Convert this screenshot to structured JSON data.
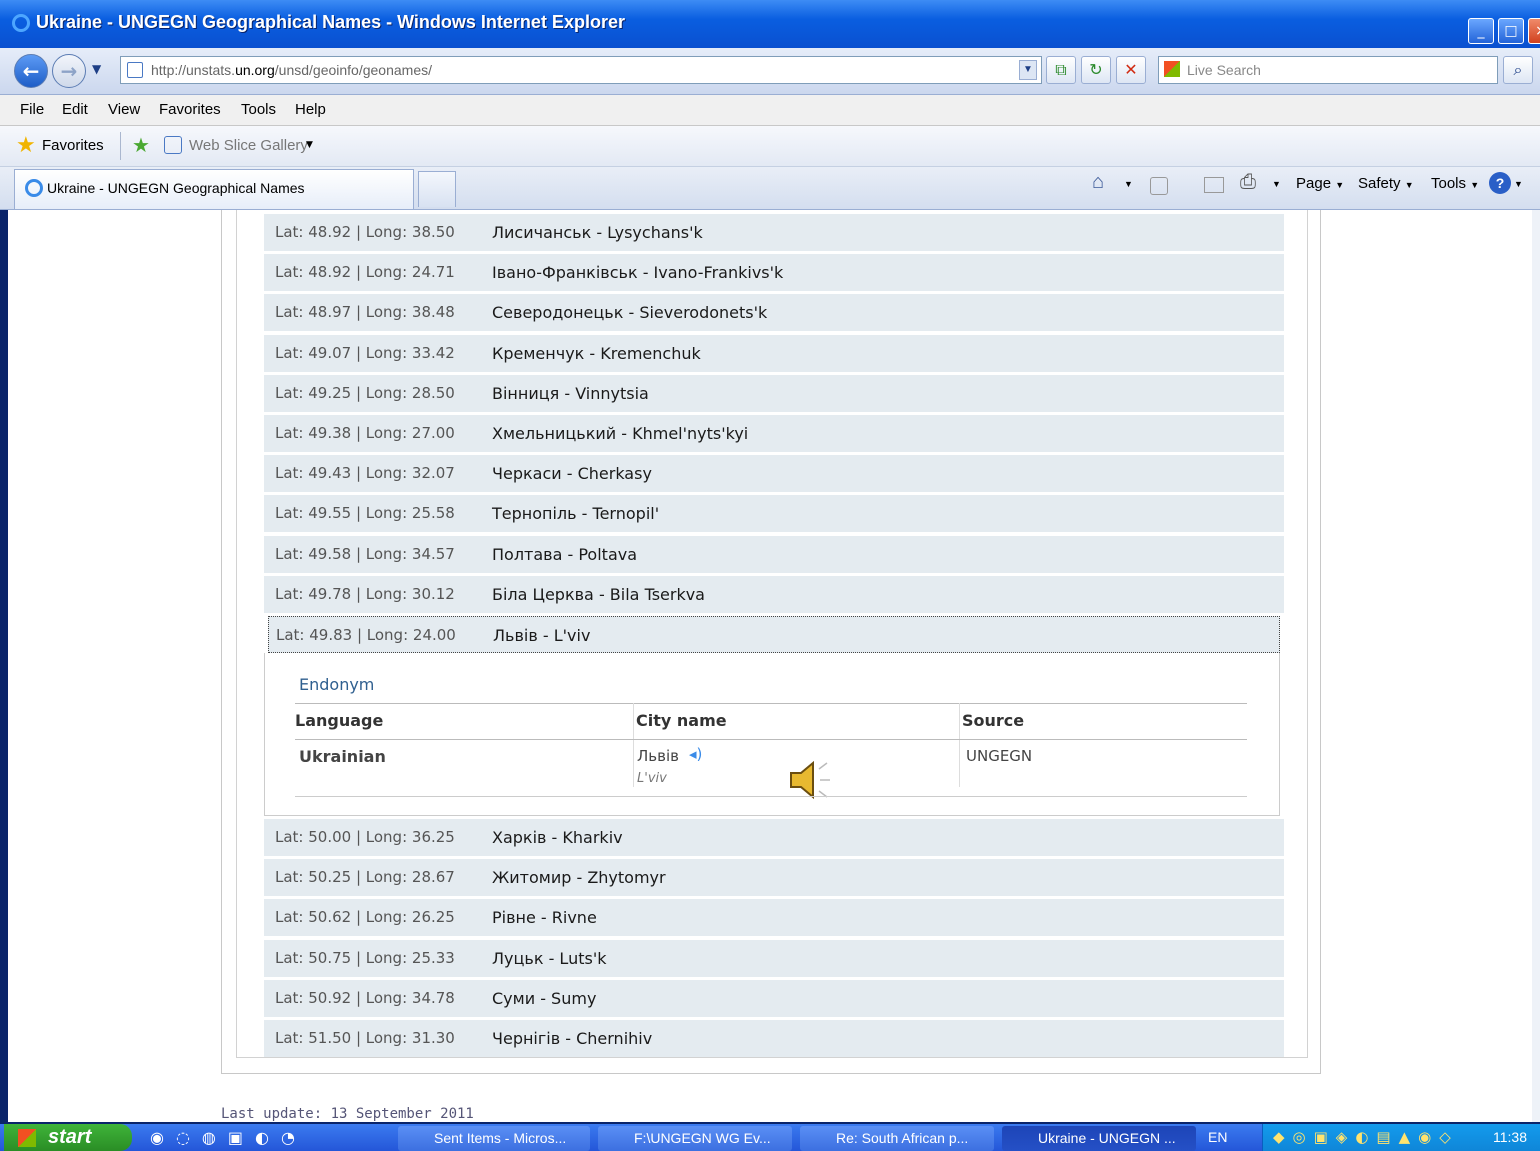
{
  "window": {
    "title": "Ukraine - UNGEGN Geographical Names - Windows Internet Explorer"
  },
  "nav": {
    "url_prefix": "http://unstats.",
    "url_domain": "un.org",
    "url_path": "/unsd/geoinfo/geonames/",
    "search_placeholder": "Live Search"
  },
  "menu": [
    "File",
    "Edit",
    "View",
    "Favorites",
    "Tools",
    "Help"
  ],
  "favorites": {
    "label": "Favorites",
    "web_slice": "Web Slice Gallery"
  },
  "tab": {
    "title": "Ukraine - UNGEGN Geographical Names"
  },
  "commands": {
    "page": "Page",
    "safety": "Safety",
    "tools": "Tools"
  },
  "rows_before": [
    {
      "coords": "Lat: 48.92 | Long: 38.50",
      "name": "Лисичанськ - Lysychans'k"
    },
    {
      "coords": "Lat: 48.92 | Long: 24.71",
      "name": "Івано-Франківськ - Ivano-Frankivs'k"
    },
    {
      "coords": "Lat: 48.97 | Long: 38.48",
      "name": "Северодонецьк - Sieverodonets'k"
    },
    {
      "coords": "Lat: 49.07 | Long: 33.42",
      "name": "Кременчук - Kremenchuk"
    },
    {
      "coords": "Lat: 49.25 | Long: 28.50",
      "name": "Вінниця - Vinnytsia"
    },
    {
      "coords": "Lat: 49.38 | Long: 27.00",
      "name": "Хмельницький - Khmel'nyts'kyi"
    },
    {
      "coords": "Lat: 49.43 | Long: 32.07",
      "name": "Черкаси - Cherkasy"
    },
    {
      "coords": "Lat: 49.55 | Long: 25.58",
      "name": "Тернопіль - Ternopil'"
    },
    {
      "coords": "Lat: 49.58 | Long: 34.57",
      "name": "Полтава - Poltava"
    },
    {
      "coords": "Lat: 49.78 | Long: 30.12",
      "name": "Біла Церква - Bila Tserkva"
    }
  ],
  "selected_row": {
    "coords": "Lat: 49.83 | Long: 24.00",
    "name": "Львів - L'viv"
  },
  "detail": {
    "section": "Endonym",
    "headers": {
      "language": "Language",
      "city": "City name",
      "source": "Source"
    },
    "language": "Ukrainian",
    "city_name": "Львів",
    "city_translit": "L'viv",
    "source": "UNGEGN"
  },
  "rows_after": [
    {
      "coords": "Lat: 50.00 | Long: 36.25",
      "name": "Харків - Kharkiv"
    },
    {
      "coords": "Lat: 50.25 | Long: 28.67",
      "name": "Житомир - Zhytomyr"
    },
    {
      "coords": "Lat: 50.62 | Long: 26.25",
      "name": "Рівне - Rivne"
    },
    {
      "coords": "Lat: 50.75 | Long: 25.33",
      "name": "Луцьк - Luts'k"
    },
    {
      "coords": "Lat: 50.92 | Long: 34.78",
      "name": "Суми - Sumy"
    },
    {
      "coords": "Lat: 51.50 | Long: 31.30",
      "name": "Чернігів - Chernihiv"
    }
  ],
  "footer": "Last update: 13 September 2011",
  "taskbar": {
    "start": "start",
    "tasks": [
      "Sent Items - Micros...",
      "F:\\UNGEGN WG Ev...",
      "Re: South African p...",
      "Ukraine - UNGEGN ..."
    ],
    "lang": "EN",
    "clock": "11:38"
  }
}
